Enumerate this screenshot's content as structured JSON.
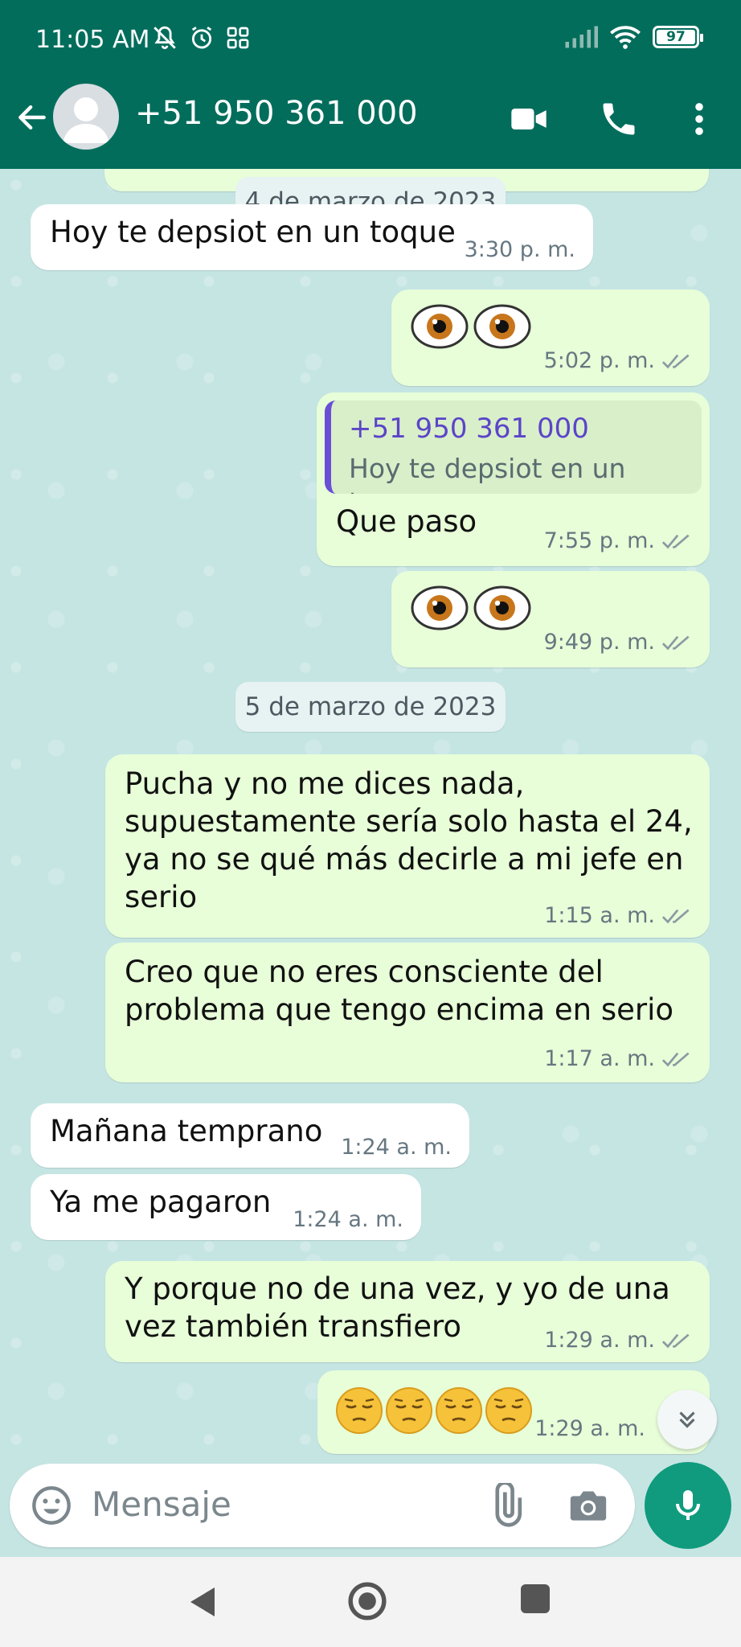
{
  "status_bar": {
    "time": "11:05 AM",
    "battery": "97",
    "icons": [
      "mute-bell-icon",
      "alarm-icon",
      "apps-grid-icon",
      "signal-icon",
      "wifi-icon",
      "battery-icon"
    ]
  },
  "header": {
    "contact": "+51 950 361 000",
    "icons": [
      "back-arrow-icon",
      "avatar",
      "video-call-icon",
      "phone-icon",
      "more-vert-icon"
    ],
    "color": "#036d5c"
  },
  "chat": {
    "date1": "4 de marzo de 2023",
    "date2": "5 de marzo de 2023",
    "messages": [
      {
        "dir": "in",
        "text": "Hoy te depsiot en un toque",
        "time": "3:30 p. m."
      },
      {
        "dir": "out",
        "emoji": "eyes",
        "time": "5:02 p. m."
      },
      {
        "dir": "out",
        "quote_name": "+51 950 361 000",
        "quote_text": "Hoy te depsiot en un toque",
        "text": "Que paso",
        "time": "7:55 p. m."
      },
      {
        "dir": "out",
        "emoji": "eyes",
        "time": "9:49 p. m."
      },
      {
        "dir": "out",
        "text": "Pucha y no me dices nada,\nsupuestamente sería solo hasta el 24,\nya no se qué más decirle a mi jefe en\nserio",
        "time": "1:15 a. m."
      },
      {
        "dir": "out",
        "text": "Creo que no eres consciente del\nproblema que tengo encima en serio",
        "time": "1:17 a. m."
      },
      {
        "dir": "in",
        "text": "Mañana temprano",
        "time": "1:24 a. m."
      },
      {
        "dir": "in",
        "text": "Ya me pagaron",
        "time": "1:24 a. m."
      },
      {
        "dir": "out",
        "text": "Y porque no de una vez, y yo de una\nvez también transfiero",
        "time": "1:29 a. m."
      },
      {
        "dir": "out",
        "emoji": "pensive-faces",
        "time": "1:29 a. m."
      }
    ],
    "bubble_colors": {
      "in": "#ffffff",
      "out": "#e7fed8"
    }
  },
  "composer": {
    "placeholder": "Mensaje",
    "icons": [
      "emoji-icon",
      "attach-icon",
      "camera-icon",
      "mic-icon"
    ],
    "accent": "#109b7e"
  },
  "navbar": {
    "icons": [
      "nav-back-icon",
      "nav-home-icon",
      "nav-recents-icon"
    ]
  }
}
